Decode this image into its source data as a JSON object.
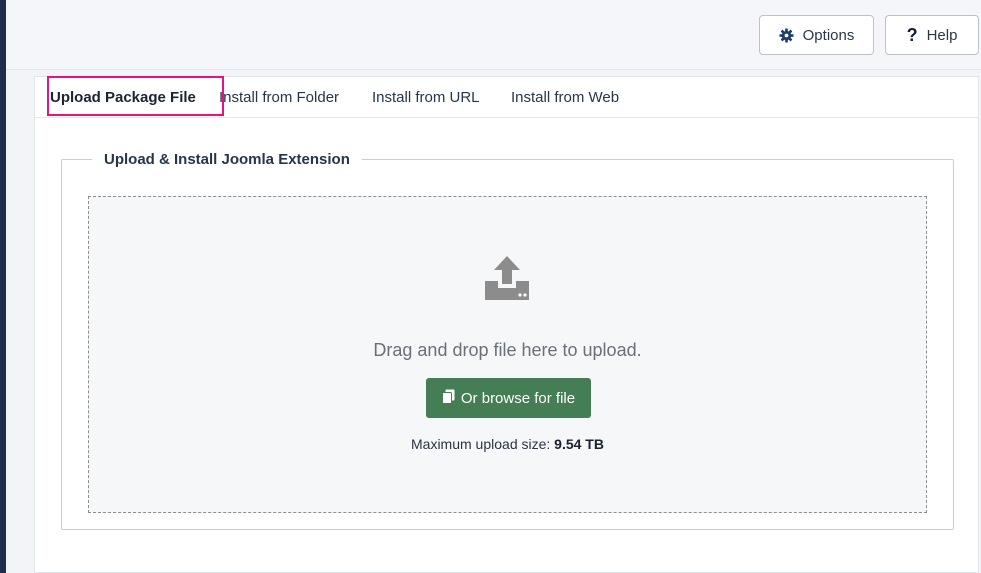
{
  "toolbar": {
    "options_label": "Options",
    "help_icon_glyph": "?",
    "help_label": "Help",
    "options_icon": "gear-icon",
    "help_icon": "question-icon"
  },
  "tabs": [
    {
      "label": "Upload Package File",
      "active": true
    },
    {
      "label": "Install from Folder",
      "active": false
    },
    {
      "label": "Install from URL",
      "active": false
    },
    {
      "label": "Install from Web",
      "active": false
    }
  ],
  "fieldset": {
    "legend": "Upload & Install Joomla Extension"
  },
  "dropzone": {
    "icon": "upload-icon",
    "drag_text": "Drag and drop file here to upload.",
    "browse_label": "Or browse for file",
    "browse_icon": "copy-icon",
    "max_size_label": "Maximum upload size:",
    "max_size_value": "9.54 TB"
  },
  "colors": {
    "sidebar_edge": "#1f2d4a",
    "highlight_border": "#e1128a",
    "browse_button": "#457d54",
    "upload_icon": "#8c8c8c"
  }
}
